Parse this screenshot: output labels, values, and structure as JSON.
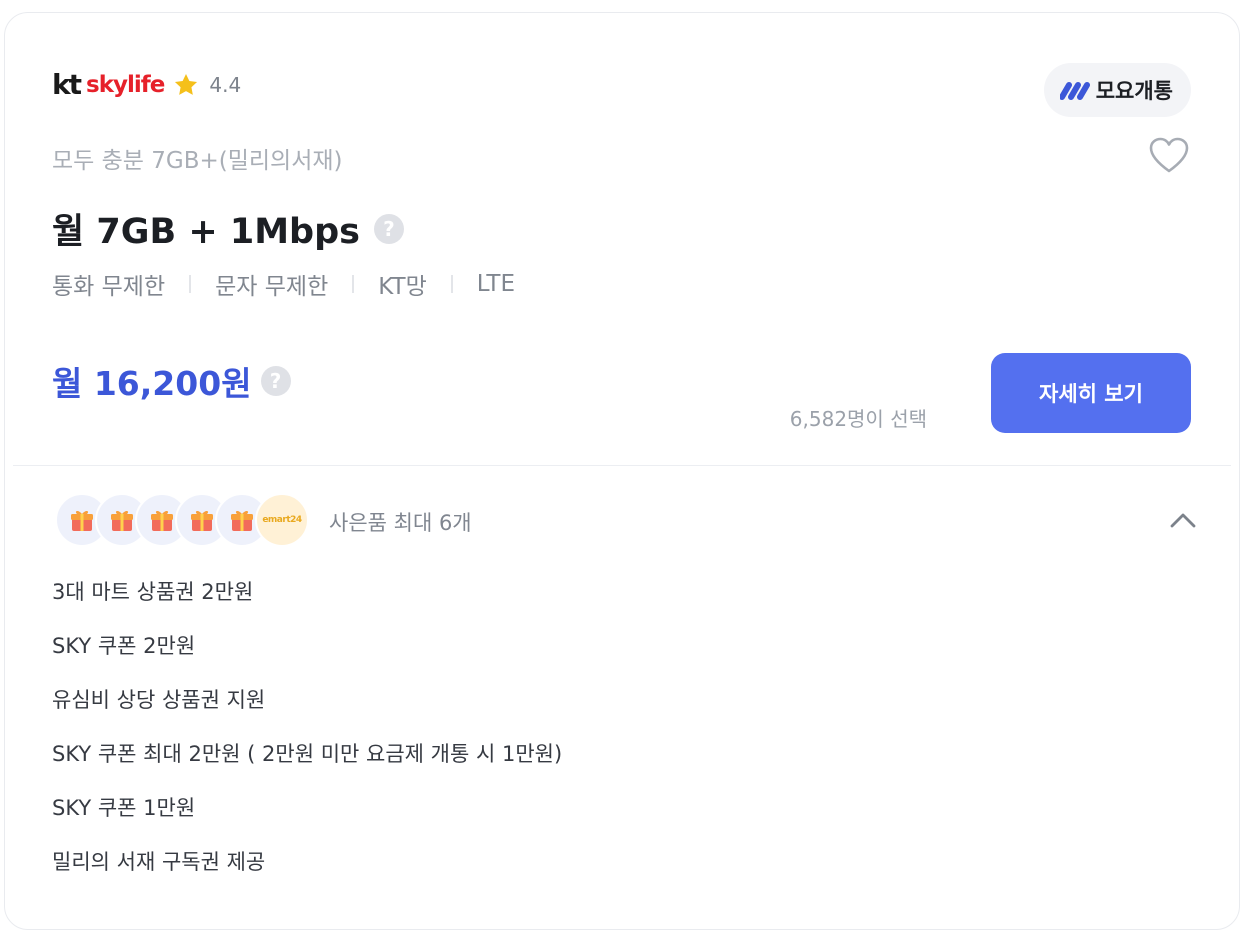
{
  "brand": {
    "logo_kt": "kt",
    "logo_name": "skylife",
    "rating": "4.4",
    "star_color": "#f5c01b"
  },
  "agent": {
    "name": "모요개통",
    "icon": "moyo-logo-icon",
    "icon_color": "#3c57d8"
  },
  "plan": {
    "subtitle": "모두 충분 7GB+(밀리의서재)",
    "title": "월 7GB + 1Mbps",
    "help": "?",
    "specs": [
      "통화 무제한",
      "문자 무제한",
      "KT망",
      "LTE"
    ]
  },
  "price": {
    "value": "월 16,200원",
    "help": "?",
    "count": "6,582명이 선택",
    "cta": "자세히 보기",
    "accent": "#3c57d8",
    "button_color": "#5470ef"
  },
  "gifts": {
    "label": "사은품 최대 6개",
    "emart_badge": "emart24",
    "items": [
      "3대 마트 상품권 2만원",
      "SKY 쿠폰 2만원",
      "유심비 상당 상품권 지원",
      "SKY 쿠폰 최대 2만원 ( 2만원 미만 요금제 개통 시 1만원)",
      "SKY 쿠폰 1만원",
      "밀리의 서재 구독권 제공"
    ]
  }
}
